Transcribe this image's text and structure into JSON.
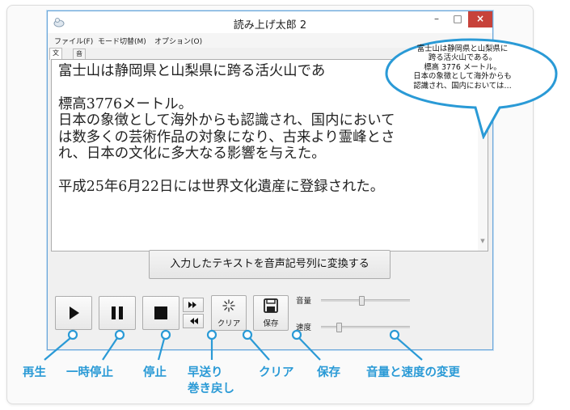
{
  "window": {
    "title": "読み上げ太郎 2",
    "minimize_glyph": "–",
    "maximize_glyph": "□",
    "close_glyph": "×"
  },
  "menu": {
    "items": [
      "ファイル(F)",
      "モード切替(M)",
      "オプション(O)"
    ]
  },
  "tabs": [
    "文章",
    "音声記号"
  ],
  "document": {
    "lines": [
      "富士山は静岡県と山梨県に跨る活火山であ",
      "",
      "標高3776メートル。",
      "日本の象徴として海外からも認識され、国内において",
      "は数多くの芸術作品の対象になり、古来より霊峰とさ",
      "れ、日本の文化に多大なる影響を与えた。",
      "",
      "平成25年6月22日には世界文化遺産に登録された。"
    ]
  },
  "convert_button": "入力したテキストを音声記号列に変換する",
  "toolbar": {
    "clear_label": "クリア",
    "save_label": "保存",
    "volume_label": "音量",
    "speed_label": "速度",
    "volume_level": 0.45,
    "speed_level": 0.2
  },
  "bubble": {
    "lines": [
      "富士山は静岡県と山梨県に",
      "跨る活火山である。",
      "標高 3776 メートル。",
      "日本の象徴として海外からも",
      "認識され、国内においては…"
    ]
  },
  "annotations": {
    "play": "再生",
    "pause": "一時停止",
    "stop": "停止",
    "ff": "早送り",
    "rewind": "巻き戻し",
    "clear": "クリア",
    "save": "保存",
    "volume_speed": "音量と速度の変更"
  },
  "colors": {
    "accent": "#2a9ad6",
    "bubble_fill": "#ffffff",
    "close_button": "#c7423a"
  }
}
